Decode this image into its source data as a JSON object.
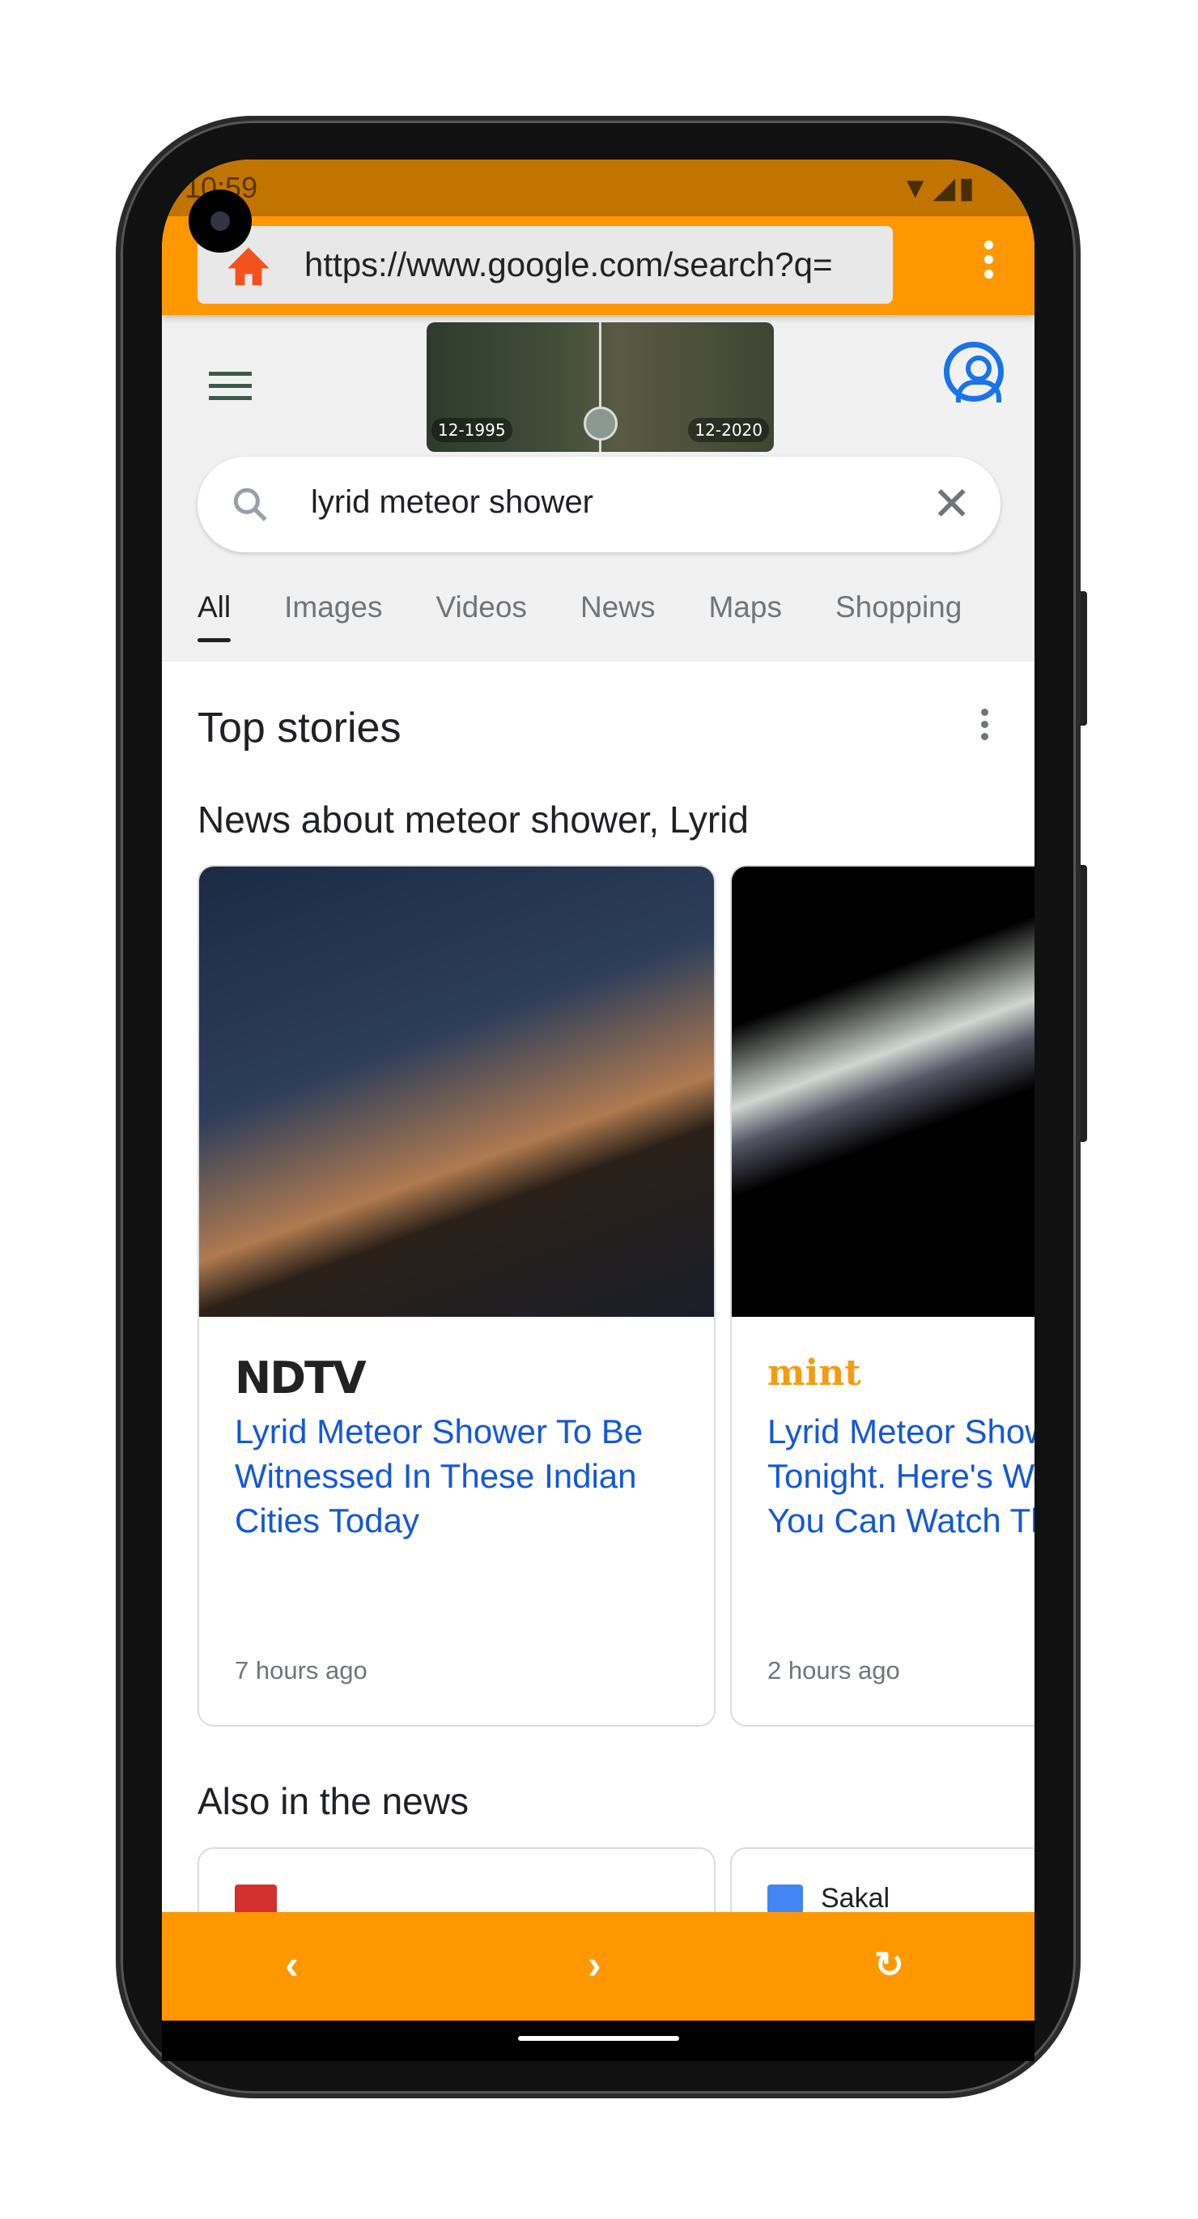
{
  "status_bar": {
    "time": "10:59",
    "icons": [
      "wifi-icon",
      "signal-icon",
      "battery-icon"
    ]
  },
  "browser": {
    "url": "https://www.google.com/search?q=",
    "accent": "#ff9800"
  },
  "doodle": {
    "left_label": "12-1995",
    "right_label": "12-2020"
  },
  "search": {
    "query": "lyrid meteor shower"
  },
  "tabs": [
    "All",
    "Images",
    "Videos",
    "News",
    "Maps",
    "Shopping"
  ],
  "top_stories": {
    "heading": "Top stories",
    "subheading": "News about meteor shower, Lyrid",
    "cards": [
      {
        "source": "NDTV",
        "title": "Lyrid Meteor Shower To Be Witnessed In These Indian Cities Today",
        "time": "7 hours ago"
      },
      {
        "source": "mint",
        "title": "Lyrid Meteor Shower To Peak Tonight. Here's When, Where You Can Watch Them | Mint",
        "time": "2 hours ago"
      }
    ]
  },
  "also_in_news": {
    "heading": "Also in the news",
    "sources": [
      "",
      "Sakal"
    ]
  }
}
